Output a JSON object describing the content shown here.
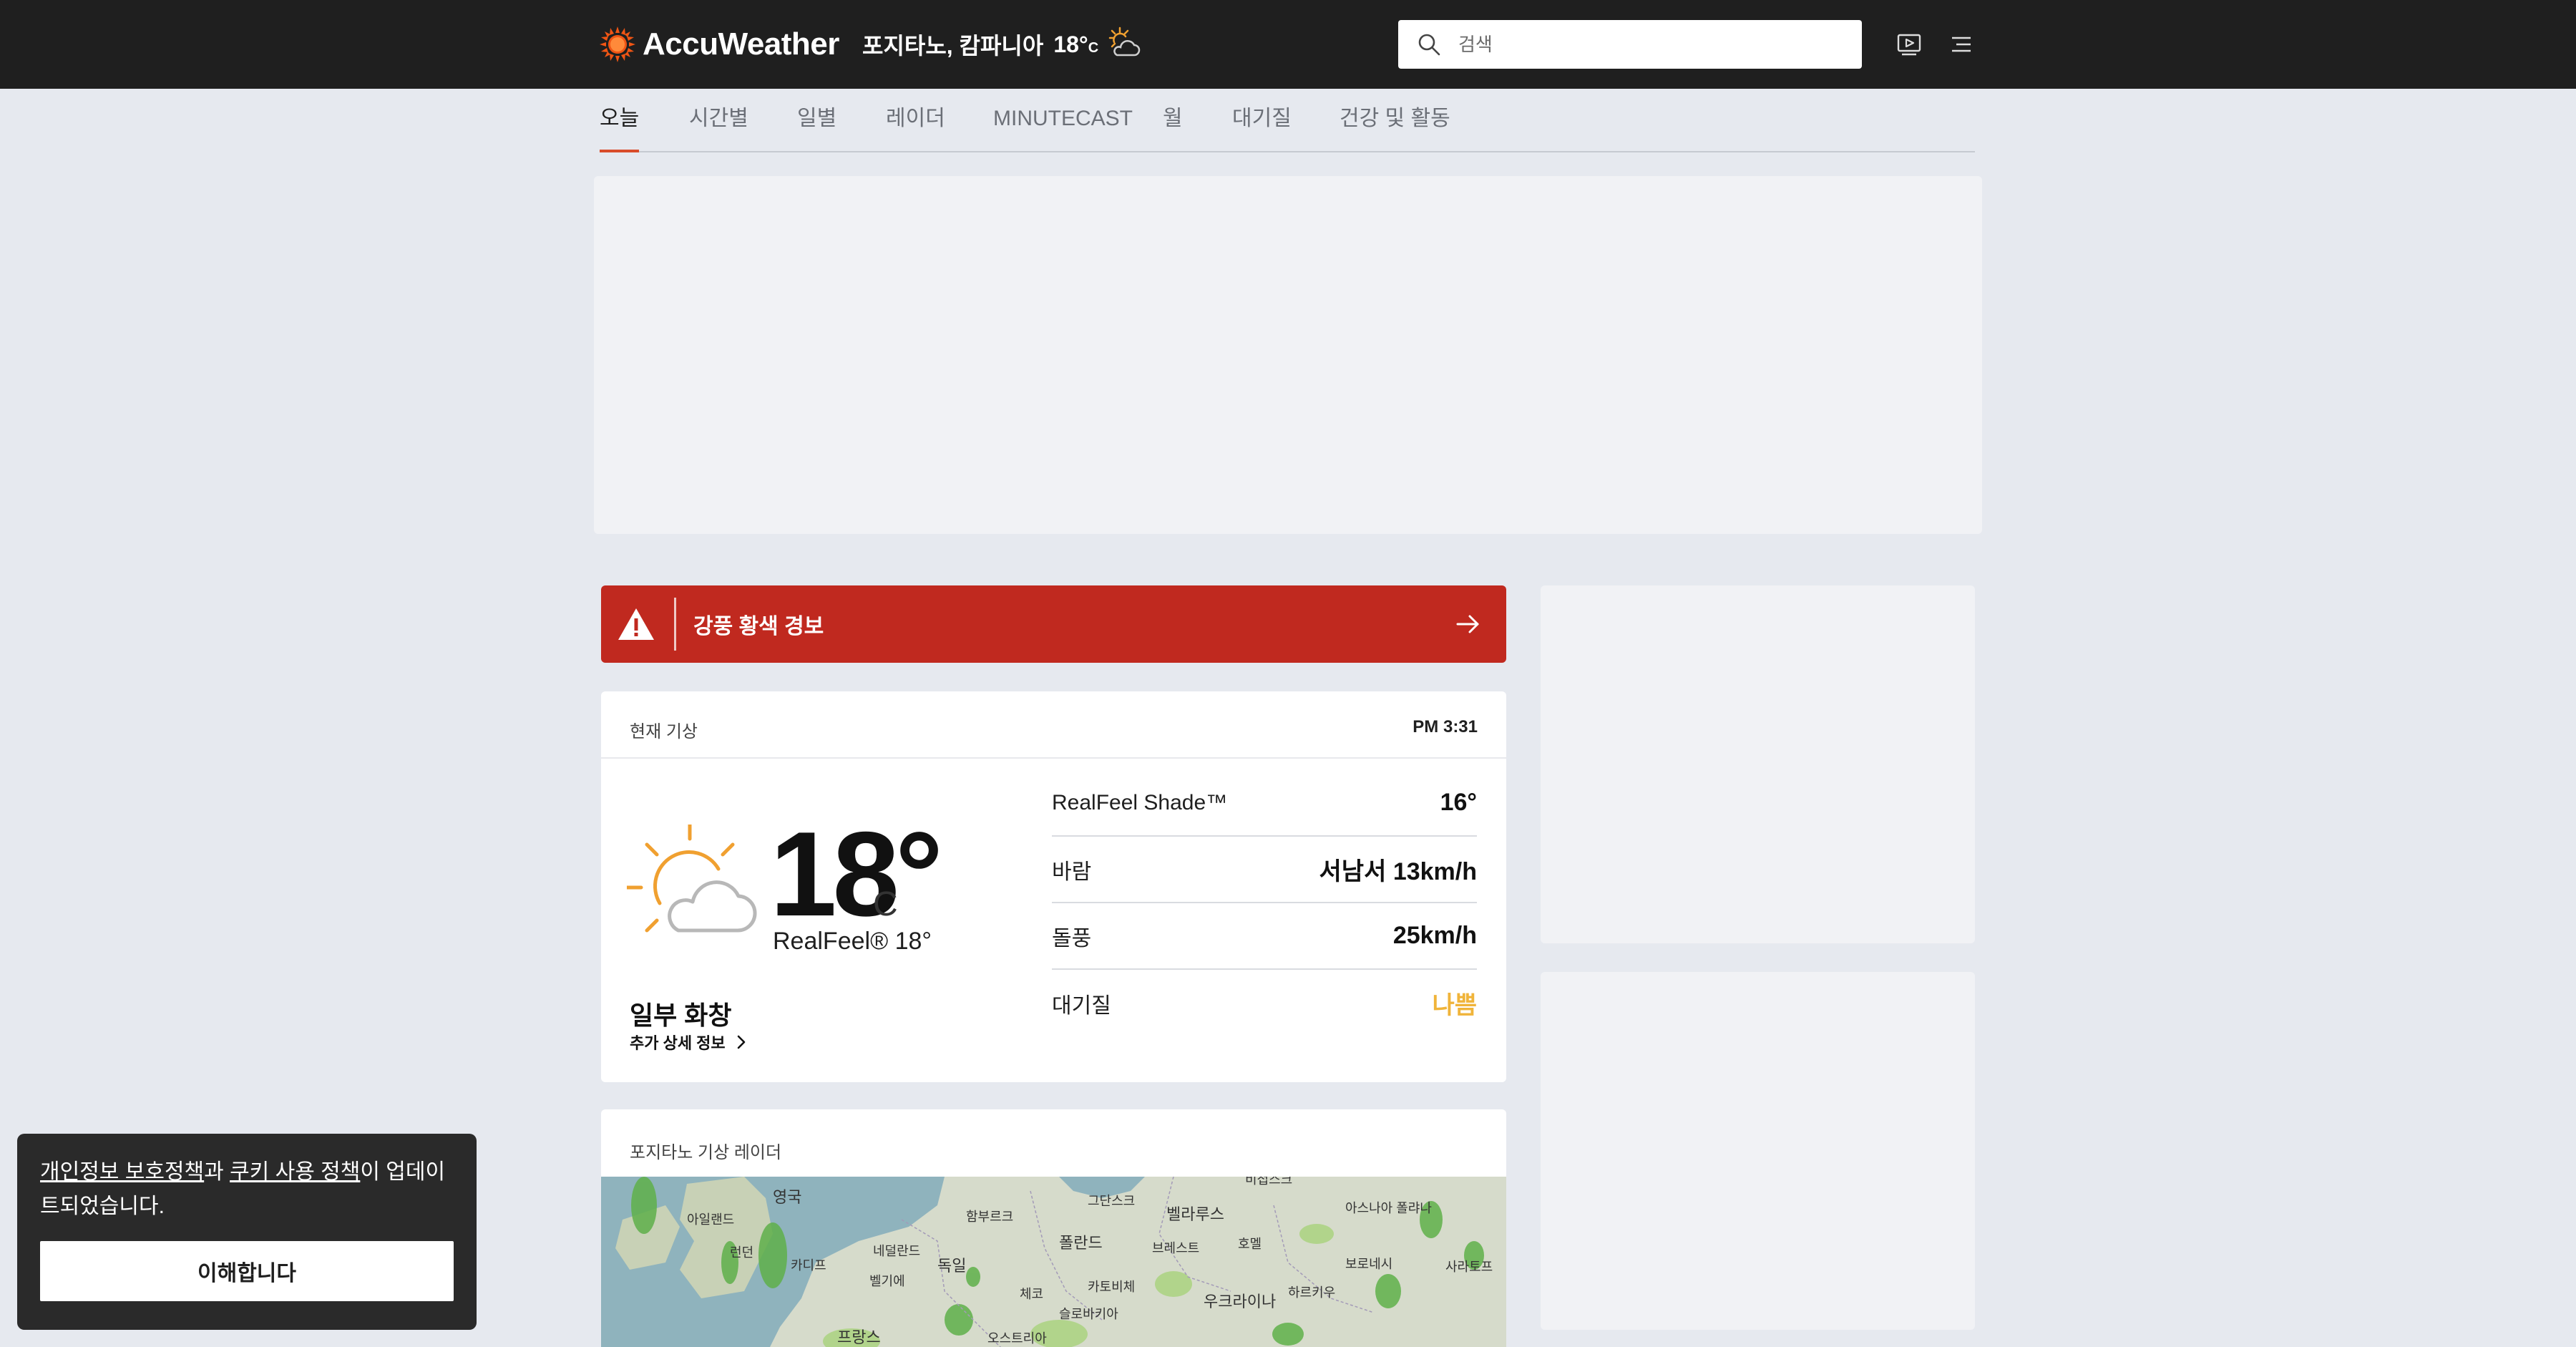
{
  "header": {
    "logo_text": "AccuWeather",
    "location": "포지타노, 캄파니아",
    "temp": "18°",
    "unit": "C",
    "condition_icon": "partly-sunny-icon",
    "search_placeholder": "검색",
    "brand_color": "#f05514"
  },
  "subnav": {
    "tabs": [
      {
        "label": "오늘",
        "active": true
      },
      {
        "label": "시간별"
      },
      {
        "label": "일별"
      },
      {
        "label": "레이더"
      },
      {
        "label": "MINUTECAST"
      },
      {
        "label": "월"
      },
      {
        "label": "대기질"
      },
      {
        "label": "건강 및 활동"
      }
    ],
    "active_color": "#d94c2a"
  },
  "alert": {
    "text": "강풍 황색 경보",
    "icon": "warning-icon",
    "background": "#c0291f"
  },
  "current": {
    "heading": "현재 기상",
    "time": "PM 3:31",
    "icon": "partly-sunny-icon",
    "temp": "18°",
    "unit": "C",
    "realfeel": "RealFeel® 18°",
    "condition": "일부 화창",
    "more_link": "추가 상세 정보",
    "details": [
      {
        "label": "RealFeel Shade™",
        "value": "16°"
      },
      {
        "label": "바람",
        "value": "서남서 13km/h"
      },
      {
        "label": "돌풍",
        "value": "25km/h"
      },
      {
        "label": "대기질",
        "value": "나쁨",
        "value_color": "#f0b43a"
      }
    ]
  },
  "radar": {
    "heading": "포지타노 기상 레이더",
    "map_labels": [
      "영국",
      "아일랜드",
      "런던",
      "카디프",
      "네덜란드",
      "벨기에",
      "독일",
      "함부르크",
      "그단스크",
      "폴란드",
      "벨라루스",
      "브레스트",
      "호멜",
      "체코",
      "카토비체",
      "슬로바키아",
      "우크라이나",
      "하르키우",
      "보로네시",
      "사라토프",
      "아스나아 폴랴나",
      "비첩스크",
      "프랑스",
      "오스트리아"
    ]
  },
  "cookie": {
    "link1": "개인정보 보호정책",
    "connector": "과 ",
    "link2": "쿠키 사용 정책",
    "suffix": "이 업데이트되었습니다.",
    "button": "이해합니다"
  }
}
